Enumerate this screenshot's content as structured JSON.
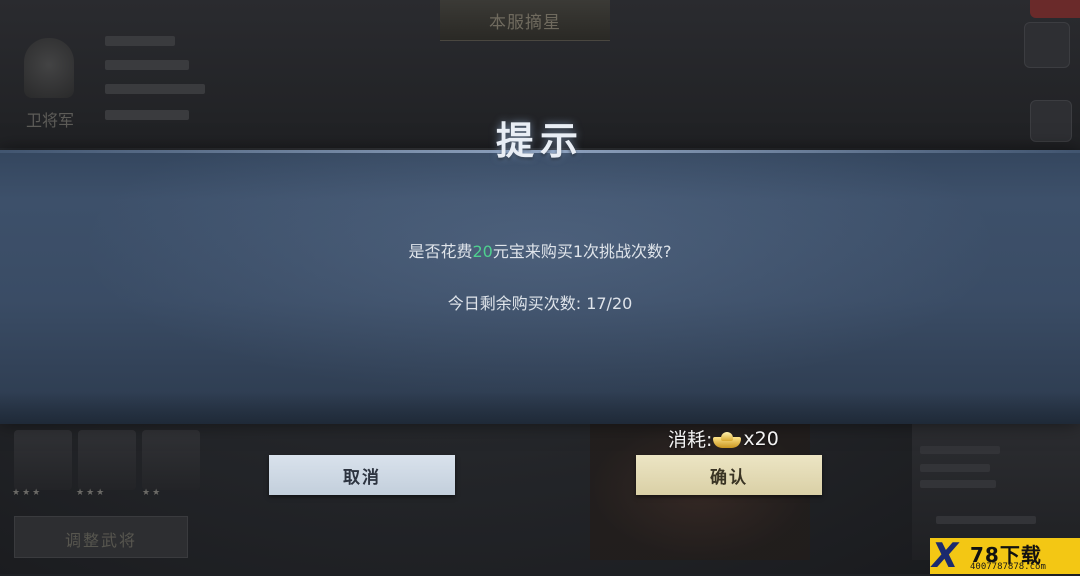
{
  "background": {
    "rank_label": "卫将军",
    "top_title": "本服摘星",
    "bottom_button_label": "调整武将",
    "hero_stars": [
      "★★★",
      "★★★",
      "★★"
    ]
  },
  "dialog": {
    "title": "提示",
    "message_prefix": "是否花费",
    "message_amount": "20",
    "message_suffix": "元宝来购买1次挑战次数?",
    "remaining_label": "今日剩余购买次数:",
    "remaining_value": "17/20"
  },
  "cost": {
    "label": "消耗:",
    "icon": "gold-ingot-icon",
    "amount": "x20"
  },
  "buttons": {
    "cancel": "取消",
    "confirm": "确认"
  },
  "watermark": {
    "logo": "X",
    "name": "78下载",
    "phone": "4007787878.com"
  },
  "colors": {
    "highlight": "#4fd08f",
    "dialog_band": "#3d506a",
    "cancel_button": "#c3cfdc",
    "confirm_button": "#dad0a6"
  }
}
